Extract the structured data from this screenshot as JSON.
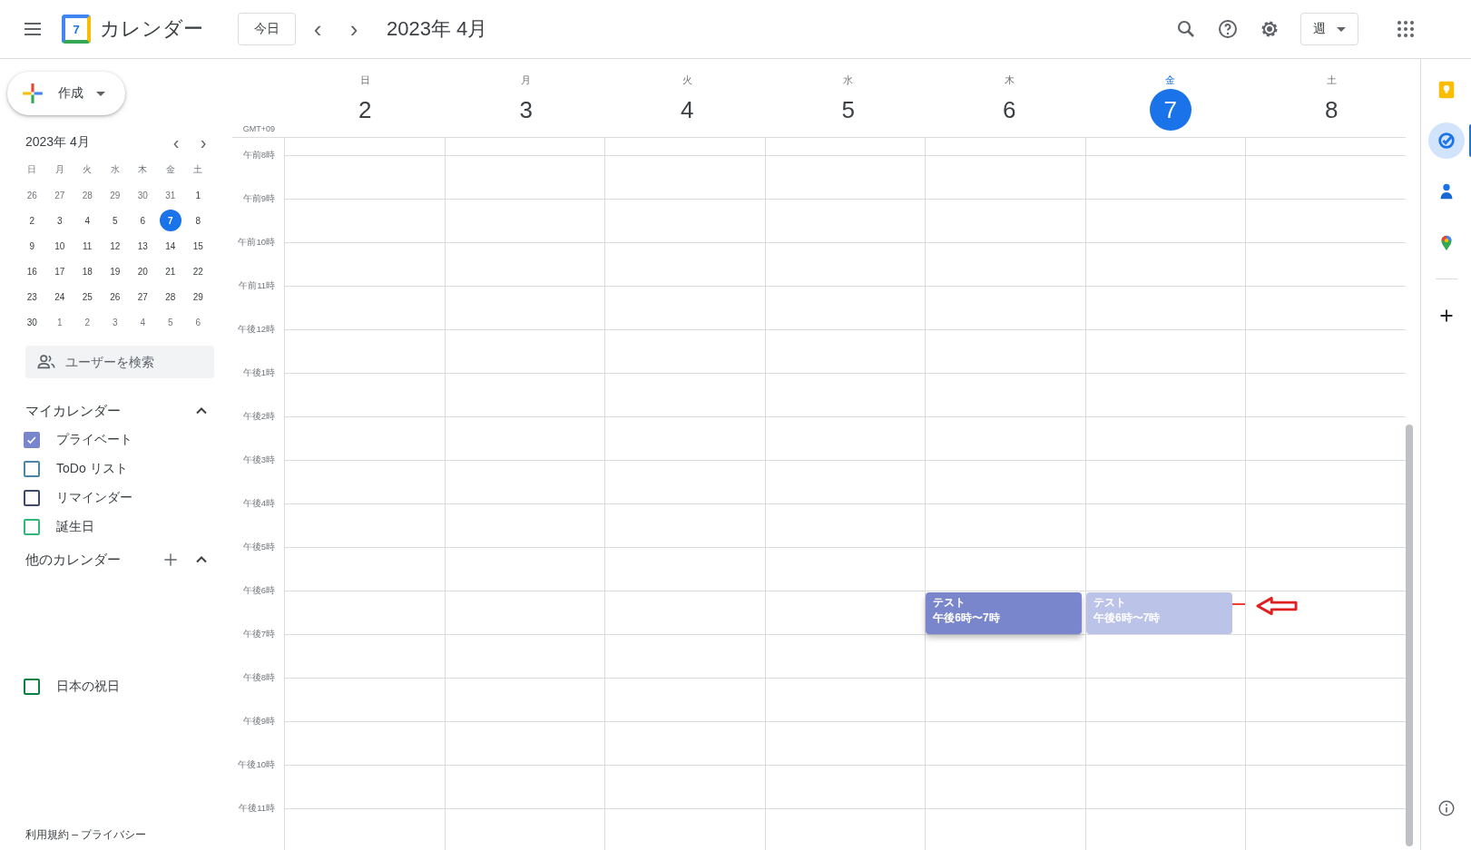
{
  "header": {
    "app_name": "カレンダー",
    "logo_day": "7",
    "today_button": "今日",
    "prev": "‹",
    "next": "›",
    "period": "2023年 4月",
    "view": "週"
  },
  "sidebar": {
    "create": "作成",
    "mini_calendar": {
      "title": "2023年 4月",
      "weekdays": [
        "日",
        "月",
        "火",
        "水",
        "木",
        "金",
        "土"
      ],
      "weeks": [
        [
          {
            "d": "26",
            "muted": true,
            "selected": false
          },
          {
            "d": "27",
            "muted": true,
            "selected": false
          },
          {
            "d": "28",
            "muted": true,
            "selected": false
          },
          {
            "d": "29",
            "muted": true,
            "selected": false
          },
          {
            "d": "30",
            "muted": true,
            "selected": false
          },
          {
            "d": "31",
            "muted": true,
            "selected": false
          },
          {
            "d": "1",
            "muted": false,
            "selected": false
          }
        ],
        [
          {
            "d": "2",
            "muted": false,
            "selected": false
          },
          {
            "d": "3",
            "muted": false,
            "selected": false
          },
          {
            "d": "4",
            "muted": false,
            "selected": false
          },
          {
            "d": "5",
            "muted": false,
            "selected": false
          },
          {
            "d": "6",
            "muted": false,
            "selected": false
          },
          {
            "d": "7",
            "muted": false,
            "selected": true
          },
          {
            "d": "8",
            "muted": false,
            "selected": false
          }
        ],
        [
          {
            "d": "9",
            "muted": false,
            "selected": false
          },
          {
            "d": "10",
            "muted": false,
            "selected": false
          },
          {
            "d": "11",
            "muted": false,
            "selected": false
          },
          {
            "d": "12",
            "muted": false,
            "selected": false
          },
          {
            "d": "13",
            "muted": false,
            "selected": false
          },
          {
            "d": "14",
            "muted": false,
            "selected": false
          },
          {
            "d": "15",
            "muted": false,
            "selected": false
          }
        ],
        [
          {
            "d": "16",
            "muted": false,
            "selected": false
          },
          {
            "d": "17",
            "muted": false,
            "selected": false
          },
          {
            "d": "18",
            "muted": false,
            "selected": false
          },
          {
            "d": "19",
            "muted": false,
            "selected": false
          },
          {
            "d": "20",
            "muted": false,
            "selected": false
          },
          {
            "d": "21",
            "muted": false,
            "selected": false
          },
          {
            "d": "22",
            "muted": false,
            "selected": false
          }
        ],
        [
          {
            "d": "23",
            "muted": false,
            "selected": false
          },
          {
            "d": "24",
            "muted": false,
            "selected": false
          },
          {
            "d": "25",
            "muted": false,
            "selected": false
          },
          {
            "d": "26",
            "muted": false,
            "selected": false
          },
          {
            "d": "27",
            "muted": false,
            "selected": false
          },
          {
            "d": "28",
            "muted": false,
            "selected": false
          },
          {
            "d": "29",
            "muted": false,
            "selected": false
          }
        ],
        [
          {
            "d": "30",
            "muted": false,
            "selected": false
          },
          {
            "d": "1",
            "muted": true,
            "selected": false
          },
          {
            "d": "2",
            "muted": true,
            "selected": false
          },
          {
            "d": "3",
            "muted": true,
            "selected": false
          },
          {
            "d": "4",
            "muted": true,
            "selected": false
          },
          {
            "d": "5",
            "muted": true,
            "selected": false
          },
          {
            "d": "6",
            "muted": true,
            "selected": false
          }
        ]
      ]
    },
    "user_search": {
      "placeholder": "ユーザーを検索"
    },
    "my_calendars": {
      "title": "マイカレンダー",
      "expanded": true,
      "items": [
        {
          "label": "プライベート",
          "checked": true,
          "color": "#7986cb"
        },
        {
          "label": "ToDo リスト",
          "checked": false,
          "color": "#4a86a8"
        },
        {
          "label": "リマインダー",
          "checked": false,
          "color": "#3f4a6b"
        },
        {
          "label": "誕生日",
          "checked": false,
          "color": "#33b679"
        }
      ]
    },
    "other_calendars": {
      "title": "他のカレンダー",
      "expanded": true,
      "items": [
        {
          "label": "日本の祝日",
          "checked": false,
          "color": "#0b8043"
        }
      ]
    },
    "footer": "利用規約 – プライバシー"
  },
  "week": {
    "timezone": "GMT+09",
    "days": [
      {
        "weekday": "日",
        "date": "2",
        "today": false
      },
      {
        "weekday": "月",
        "date": "3",
        "today": false
      },
      {
        "weekday": "火",
        "date": "4",
        "today": false
      },
      {
        "weekday": "水",
        "date": "5",
        "today": false
      },
      {
        "weekday": "木",
        "date": "6",
        "today": false,
        "events": [
          {
            "kind": "event",
            "title": "テスト",
            "time": "午後6時〜7時"
          }
        ]
      },
      {
        "weekday": "金",
        "date": "7",
        "today": true,
        "events": [
          {
            "kind": "dragging",
            "title": "テスト",
            "time": "午後6時〜7時"
          }
        ]
      },
      {
        "weekday": "土",
        "date": "8",
        "today": false
      }
    ],
    "hours": [
      "午前8時",
      "午前9時",
      "午前10時",
      "午前11時",
      "午後12時",
      "午後1時",
      "午後2時",
      "午後3時",
      "午後4時",
      "午後5時",
      "午後6時",
      "午後7時",
      "午後8時",
      "午後9時",
      "午後10時",
      "午後11時"
    ],
    "annotations": [
      {
        "kind": "arrow"
      }
    ]
  },
  "side_panel": [
    {
      "kind": "keep",
      "selected": false
    },
    {
      "kind": "tasks",
      "selected": true
    },
    {
      "kind": "contacts",
      "selected": false
    },
    {
      "kind": "maps",
      "selected": false
    },
    {
      "kind": "add",
      "selected": false
    },
    {
      "kind": "info",
      "selected": false
    }
  ]
}
